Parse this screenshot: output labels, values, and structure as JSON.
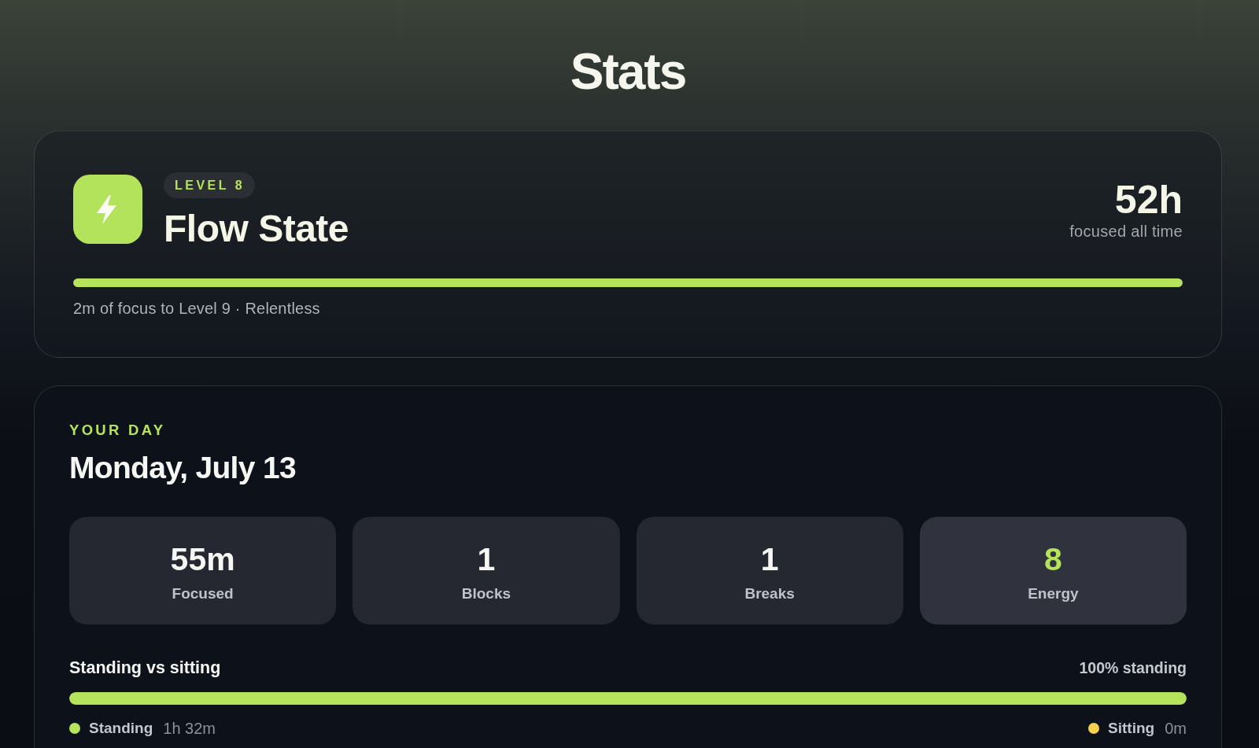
{
  "header": {
    "title": "Stats"
  },
  "level_card": {
    "badge": "LEVEL 8",
    "title": "Flow State",
    "total": "52h",
    "total_label": "focused all time",
    "progress": {
      "level": 1
    },
    "caption": "2m of focus to Level 9 · Relentless"
  },
  "day": {
    "eyebrow": "YOUR DAY",
    "date": "Monday, July 13",
    "stats": [
      {
        "value": "55m",
        "label": "Focused",
        "highlighted": false
      },
      {
        "value": "1",
        "label": "Blocks",
        "highlighted": false
      },
      {
        "value": "1",
        "label": "Breaks",
        "highlighted": false
      },
      {
        "value": "8",
        "label": "Energy",
        "highlighted": true
      }
    ],
    "posture": {
      "title": "Standing vs sitting",
      "summary": "100% standing",
      "bar": {
        "level": 1
      },
      "legend": [
        {
          "label": "Standing",
          "value": "1h 32m",
          "color": "#b5e35b"
        },
        {
          "label": "Sitting",
          "value": "0m",
          "color": "#f5cf4d"
        }
      ]
    }
  }
}
